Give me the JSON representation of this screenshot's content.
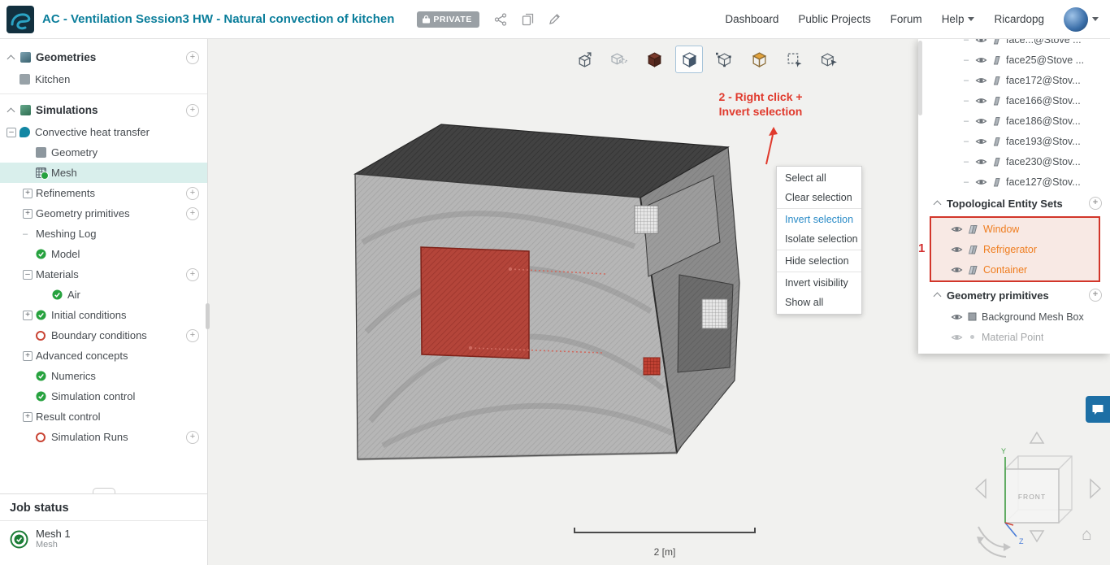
{
  "icons": {
    "plus": "+",
    "minus": "–",
    "dash": "–",
    "home": "⌂"
  },
  "header": {
    "title": "AC - Ventilation Session3 HW - Natural convection of kitchen",
    "badge": "PRIVATE",
    "nav": [
      {
        "label": "Dashboard"
      },
      {
        "label": "Public Projects"
      },
      {
        "label": "Forum"
      },
      {
        "label": "Help"
      },
      {
        "label": "Ricardopg"
      }
    ]
  },
  "sidebar": {
    "items": [
      {
        "label": "Geometries"
      },
      {
        "label": "Kitchen"
      },
      {
        "label": "Simulations"
      },
      {
        "label": "Convective heat transfer"
      },
      {
        "label": "Geometry"
      },
      {
        "label": "Mesh"
      },
      {
        "label": "Refinements"
      },
      {
        "label": "Geometry primitives"
      },
      {
        "label": "Meshing Log"
      },
      {
        "label": "Model"
      },
      {
        "label": "Materials"
      },
      {
        "label": "Air"
      },
      {
        "label": "Initial conditions"
      },
      {
        "label": "Boundary conditions"
      },
      {
        "label": "Advanced concepts"
      },
      {
        "label": "Numerics"
      },
      {
        "label": "Simulation control"
      },
      {
        "label": "Result control"
      },
      {
        "label": "Simulation Runs"
      }
    ],
    "job_status": {
      "title": "Job status",
      "name": "Mesh 1",
      "type": "Mesh"
    }
  },
  "context_menu": {
    "items": [
      {
        "label": "Select all"
      },
      {
        "label": "Clear selection"
      },
      {
        "label": "Invert selection"
      },
      {
        "label": "Isolate selection"
      },
      {
        "label": "Hide selection"
      },
      {
        "label": "Invert visibility"
      },
      {
        "label": "Show all"
      }
    ]
  },
  "annotations": {
    "step1": "1",
    "step2_line1": "2 - Right click +",
    "step2_line2": "Invert selection"
  },
  "viewport": {
    "scale_label": "2 [m]",
    "view_cube_front": "FRONT",
    "axis_y": "Y",
    "axis_z": "Z"
  },
  "scene_tree": {
    "partial_face": {
      "label": "face...@Stove ..."
    },
    "faces": [
      {
        "label": "face25@Stove ..."
      },
      {
        "label": "face172@Stov..."
      },
      {
        "label": "face166@Stov..."
      },
      {
        "label": "face186@Stov..."
      },
      {
        "label": "face193@Stov..."
      },
      {
        "label": "face230@Stov..."
      },
      {
        "label": "face127@Stov..."
      }
    ],
    "tes_header": "Topological Entity Sets",
    "tes_items": [
      {
        "label": "Window"
      },
      {
        "label": "Refrigerator"
      },
      {
        "label": "Container"
      }
    ],
    "gp_header": "Geometry primitives",
    "gp_items": [
      {
        "label": "Background Mesh Box"
      },
      {
        "label": "Material Point"
      }
    ]
  },
  "colors": {
    "accent_teal": "#0b7e9b",
    "selection_red": "#d2362a",
    "entity_orange": "#ef7d1f",
    "link_blue": "#2a8bc7",
    "chat_blue": "#1d6fa5"
  }
}
